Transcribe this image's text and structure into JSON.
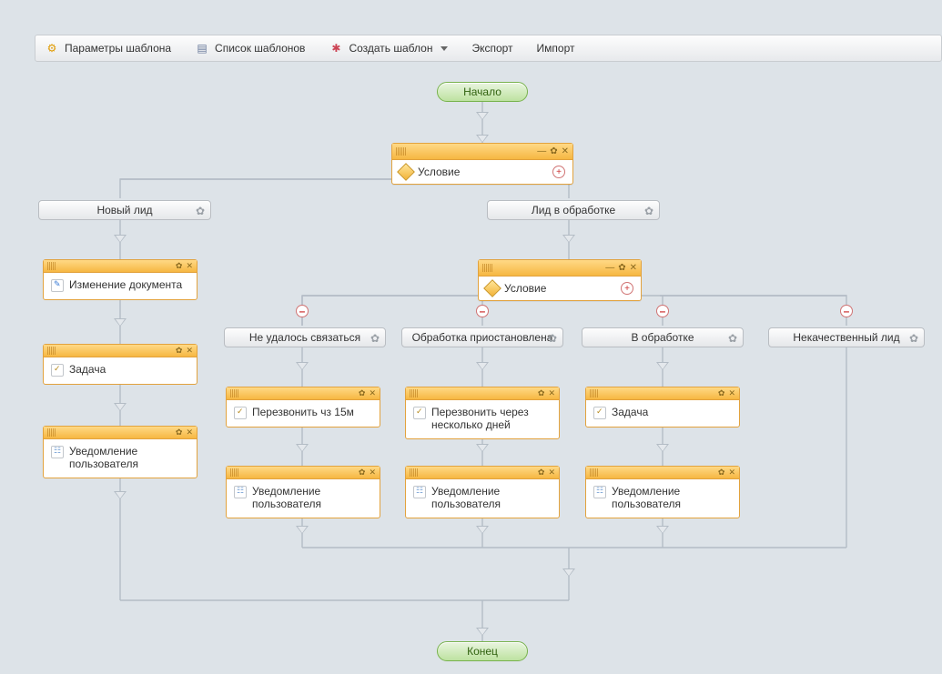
{
  "toolbar": {
    "params": "Параметры шаблона",
    "list": "Список шаблонов",
    "create": "Создать шаблон",
    "export": "Экспорт",
    "import": "Импорт"
  },
  "nodes": {
    "start": "Начало",
    "end": "Конец",
    "condition1": "Условие",
    "condition2": "Условие",
    "branch_new_lead": "Новый лид",
    "branch_in_processing_lead": "Лид в обработке",
    "branch_couldnt_reach": "Не удалось связаться",
    "branch_processing_paused": "Обработка приостановлена",
    "branch_in_work": "В обработке",
    "branch_bad_lead": "Некачественный лид",
    "act_change_doc": "Изменение документа",
    "act_task1": "Задача",
    "act_notify1": "Уведомление пользователя",
    "act_callback_15m": "Перезвонить чз 15м",
    "act_callback_days": "Перезвонить через несколько дней",
    "act_task2": "Задача",
    "act_notify2": "Уведомление пользователя",
    "act_notify3": "Уведомление пользователя",
    "act_notify4": "Уведомление пользователя"
  }
}
